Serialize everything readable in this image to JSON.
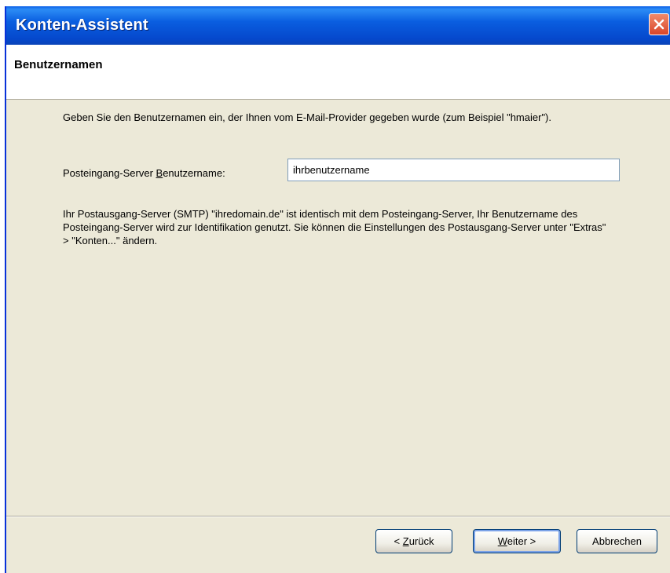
{
  "window": {
    "title": "Konten-Assistent"
  },
  "header": {
    "title": "Benutzernamen"
  },
  "content": {
    "intro_text": "Geben Sie den Benutzernamen ein, der Ihnen vom E-Mail-Provider gegeben wurde (zum Beispiel \"hmaier\").",
    "username_label_prefix": "Posteingang-Server ",
    "username_label_access_key": "B",
    "username_label_suffix": "enutzername:",
    "username_value": "ihrbenutzername",
    "info_text": "Ihr Postausgang-Server (SMTP) \"ihredomain.de\" ist identisch mit dem Posteingang-Server, Ihr Benutzername des Posteingang-Server wird zur Identifikation genutzt. Sie können die Einstellungen des Postausgang-Server unter \"Extras\" > \"Konten...\" ändern."
  },
  "buttons": {
    "back_prefix": "< ",
    "back_access_key": "Z",
    "back_suffix": "urück",
    "next_access_key": "W",
    "next_suffix": "eiter >",
    "cancel_label": "Abbrechen"
  },
  "colors": {
    "titlebar": "#0548cc",
    "dialog_background": "#ece9d8",
    "close_button": "#d9452a",
    "input_border": "#7f9db9"
  }
}
